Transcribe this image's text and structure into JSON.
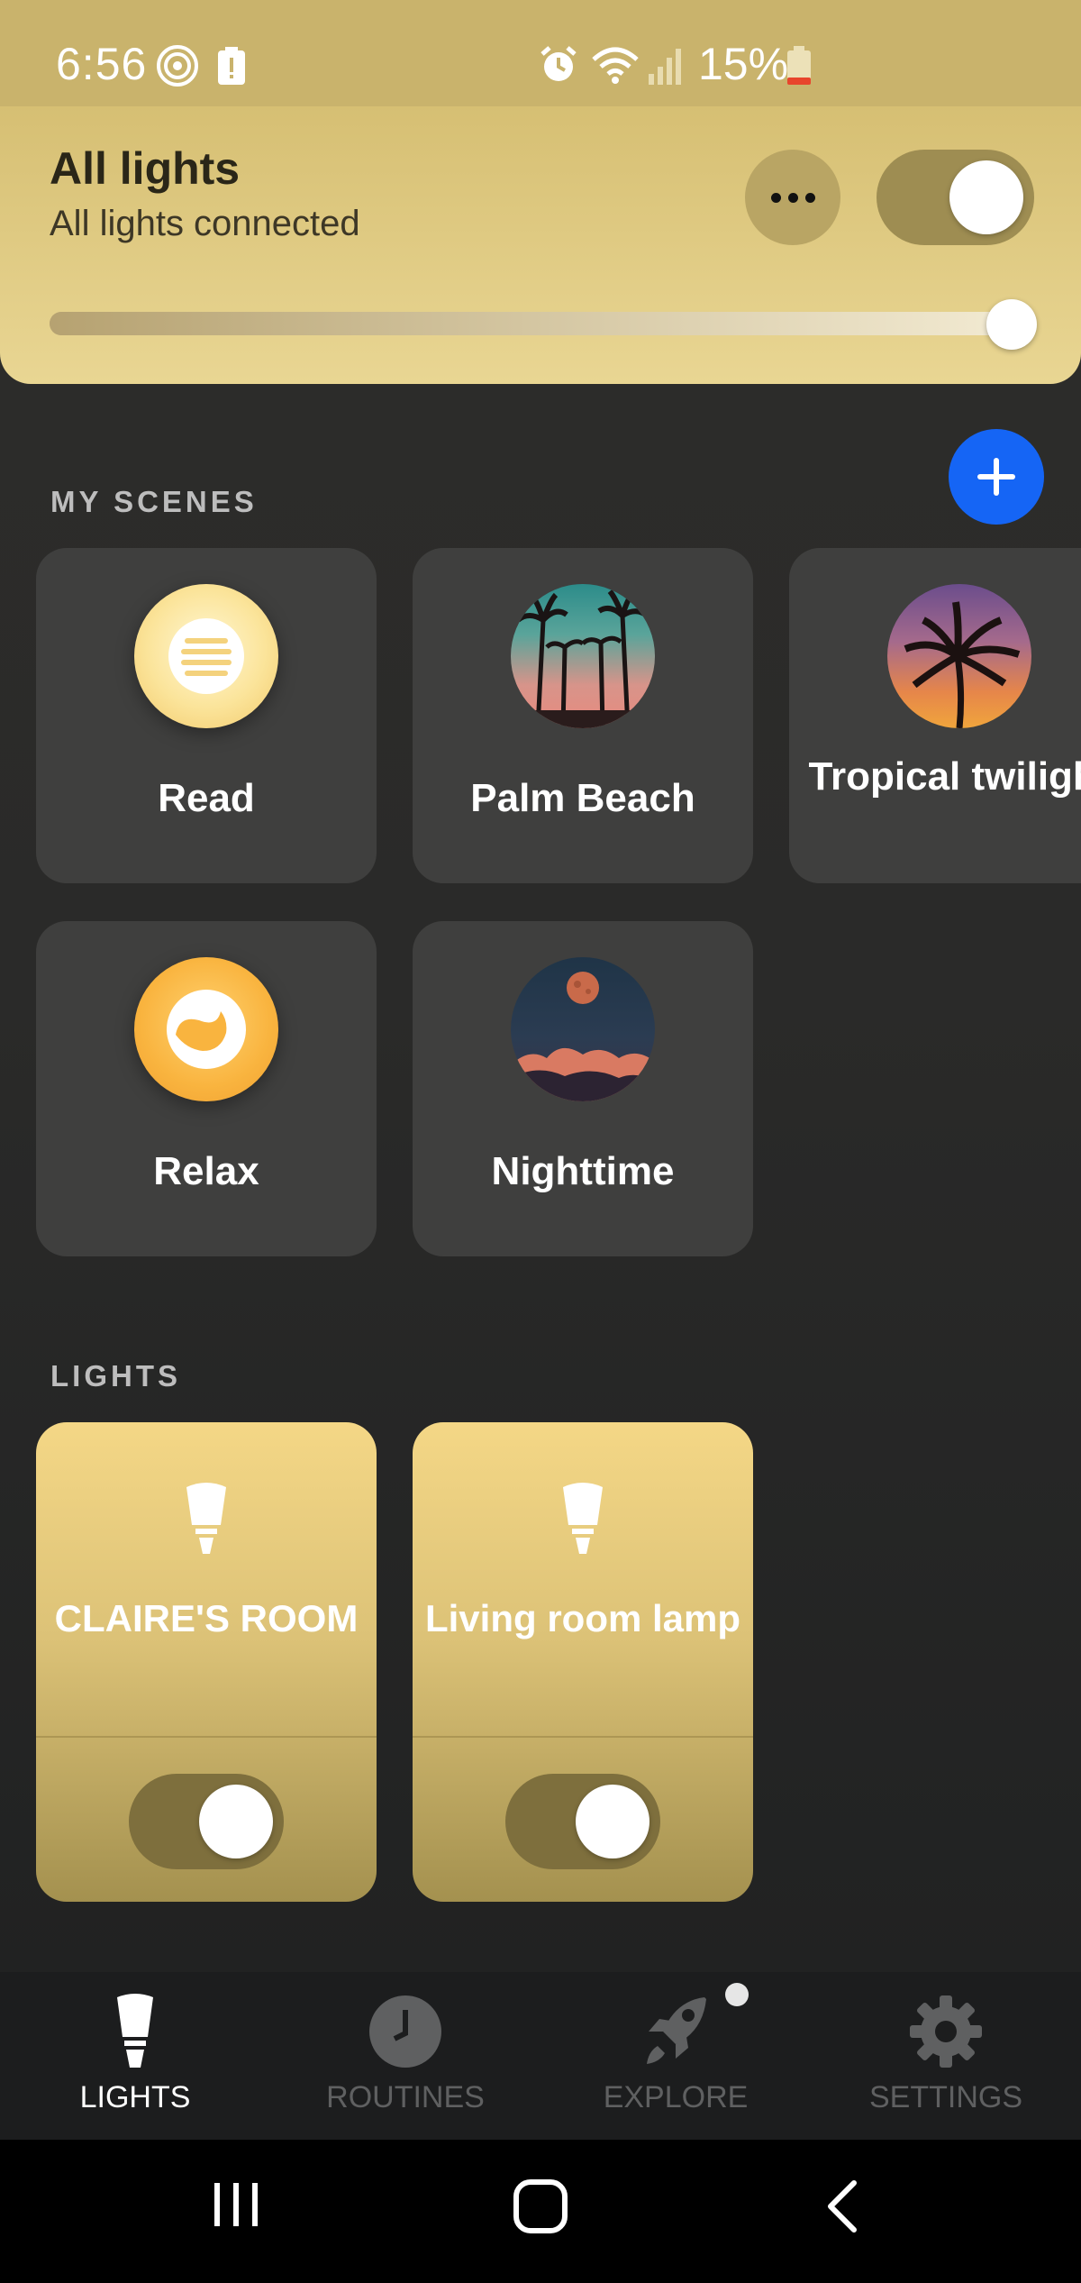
{
  "status_bar": {
    "time": "6:56",
    "battery": "15%"
  },
  "header": {
    "title": "All lights",
    "subtitle": "All lights connected",
    "toggle_on": true,
    "brightness_fraction": 0.98
  },
  "scenes_section": {
    "label": "MY SCENES",
    "scenes": [
      {
        "label": "Read"
      },
      {
        "label": "Palm Beach"
      },
      {
        "label": "Tropical twilight"
      },
      {
        "label": "Relax"
      },
      {
        "label": "Nighttime"
      }
    ]
  },
  "lights_section": {
    "label": "LIGHTS",
    "lights": [
      {
        "name": "CLAIRE'S ROOM",
        "on": true
      },
      {
        "name": "Living room lamp",
        "on": true
      }
    ]
  },
  "bottom_nav": {
    "items": [
      {
        "label": "LIGHTS",
        "icon": "bulb-icon",
        "active": true
      },
      {
        "label": "ROUTINES",
        "icon": "clock-icon",
        "active": false
      },
      {
        "label": "EXPLORE",
        "icon": "rocket-icon",
        "active": false
      },
      {
        "label": "SETTINGS",
        "icon": "gear-icon",
        "active": false
      }
    ]
  },
  "colors": {
    "accent_blue": "#1565f5",
    "header_gold": "#d6bf73",
    "card_dark": "#3f3f3e"
  }
}
